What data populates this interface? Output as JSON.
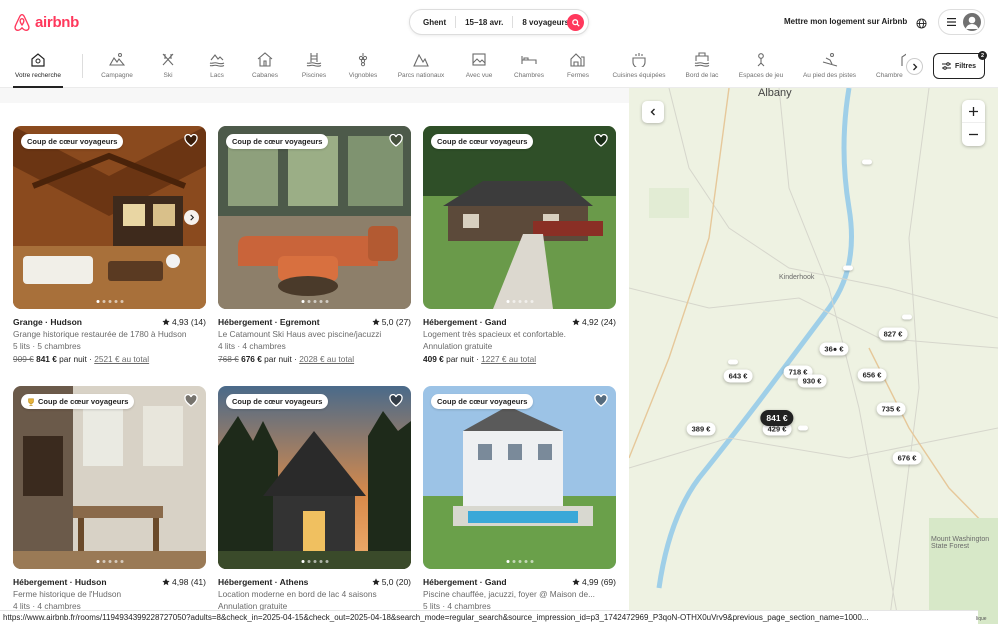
{
  "header": {
    "logo_text": "airbnb",
    "search": {
      "location": "Ghent",
      "dates": "15–18 avr.",
      "guests": "8 voyageurs"
    },
    "host_link": "Mettre mon logement sur Airbnb"
  },
  "categories": [
    {
      "label": "Votre recherche",
      "icon": "search-house-icon",
      "active": true
    },
    {
      "label": "Campagne",
      "icon": "countryside-icon"
    },
    {
      "label": "Ski",
      "icon": "ski-icon"
    },
    {
      "label": "Lacs",
      "icon": "lake-icon"
    },
    {
      "label": "Cabanes",
      "icon": "cabin-icon"
    },
    {
      "label": "Piscines",
      "icon": "pool-icon"
    },
    {
      "label": "Vignobles",
      "icon": "vineyard-icon"
    },
    {
      "label": "Parcs nationaux",
      "icon": "national-park-icon"
    },
    {
      "label": "Avec vue",
      "icon": "view-icon"
    },
    {
      "label": "Chambres",
      "icon": "room-icon"
    },
    {
      "label": "Fermes",
      "icon": "farm-icon"
    },
    {
      "label": "Cuisines équipées",
      "icon": "kitchen-icon"
    },
    {
      "label": "Bord de lac",
      "icon": "lakefront-icon"
    },
    {
      "label": "Espaces de jeu",
      "icon": "play-icon"
    },
    {
      "label": "Au pied des pistes",
      "icon": "ski-in-icon"
    },
    {
      "label": "Chambre",
      "icon": "bnb-icon"
    }
  ],
  "filters": {
    "label": "Filtres",
    "count": "2"
  },
  "listings": [
    {
      "badge": "Coup de cœur voyageurs",
      "type": "Grange",
      "location": "Hudson",
      "rating": "4,93 (14)",
      "line1": "Grange historique restaurée de 1780 à Hudson",
      "line2": "5 lits · 5 chambres",
      "old_price": "909 €",
      "price": "841 €",
      "per_night": "par nuit",
      "total": "2521 € au total"
    },
    {
      "badge": "Coup de cœur voyageurs",
      "type": "Hébergement",
      "location": "Egremont",
      "rating": "5,0 (27)",
      "line1": "Le Catamount Ski Haus avec piscine/jacuzzi",
      "line2": "4 lits · 4 chambres",
      "old_price": "768 €",
      "price": "676 €",
      "per_night": "par nuit",
      "total": "2028 € au total"
    },
    {
      "badge": "Coup de cœur voyageurs",
      "type": "Hébergement",
      "location": "Gand",
      "rating": "4,92 (24)",
      "line1": "Logement très spacieux et confortable.",
      "line2": "Annulation gratuite",
      "old_price": "",
      "price": "409 €",
      "per_night": "par nuit",
      "total": "1227 € au total"
    },
    {
      "badge": "Coup de cœur voyageurs",
      "type": "Hébergement",
      "location": "Hudson",
      "rating": "4,98 (41)",
      "line1": "Ferme historique de l'Hudson",
      "line2": "4 lits · 4 chambres",
      "old_price": "",
      "price": "",
      "per_night": "",
      "total": ""
    },
    {
      "badge": "Coup de cœur voyageurs",
      "type": "Hébergement",
      "location": "Athens",
      "rating": "5,0 (20)",
      "line1": "Location moderne en bord de lac 4 saisons",
      "line2": "Annulation gratuite",
      "old_price": "",
      "price": "",
      "per_night": "",
      "total": ""
    },
    {
      "badge": "Coup de cœur voyageurs",
      "type": "Hébergement",
      "location": "Gand",
      "rating": "4,99 (69)",
      "line1": "Piscine chauffée, jacuzzi, foyer @ Maison de...",
      "line2": "5 lits · 4 chambres",
      "old_price": "",
      "price": "",
      "per_night": "",
      "total": ""
    }
  ],
  "map": {
    "places": {
      "albany": "Albany",
      "kinderhook": "Kinderhook",
      "mount_washington": "Mount Washington State Forest"
    },
    "pins": [
      {
        "label": "827 €"
      },
      {
        "label": "36● €"
      },
      {
        "label": "718 €"
      },
      {
        "label": "930 €"
      },
      {
        "label": "656 €"
      },
      {
        "label": "643 €"
      },
      {
        "label": "735 €"
      },
      {
        "label": "841 €"
      },
      {
        "label": "429 €"
      },
      {
        "label": "389 €"
      },
      {
        "label": "676 €"
      }
    ]
  },
  "status_url": "https://www.airbnb.fr/rooms/1194934399228727050?adults=8&check_in=2025-04-15&check_out=2025-04-18&search_mode=regular_search&source_impression_id=p3_1742472969_P3qoN-OTHX0uVrv9&previous_page_section_name=1000...",
  "map_attribution": "lique"
}
